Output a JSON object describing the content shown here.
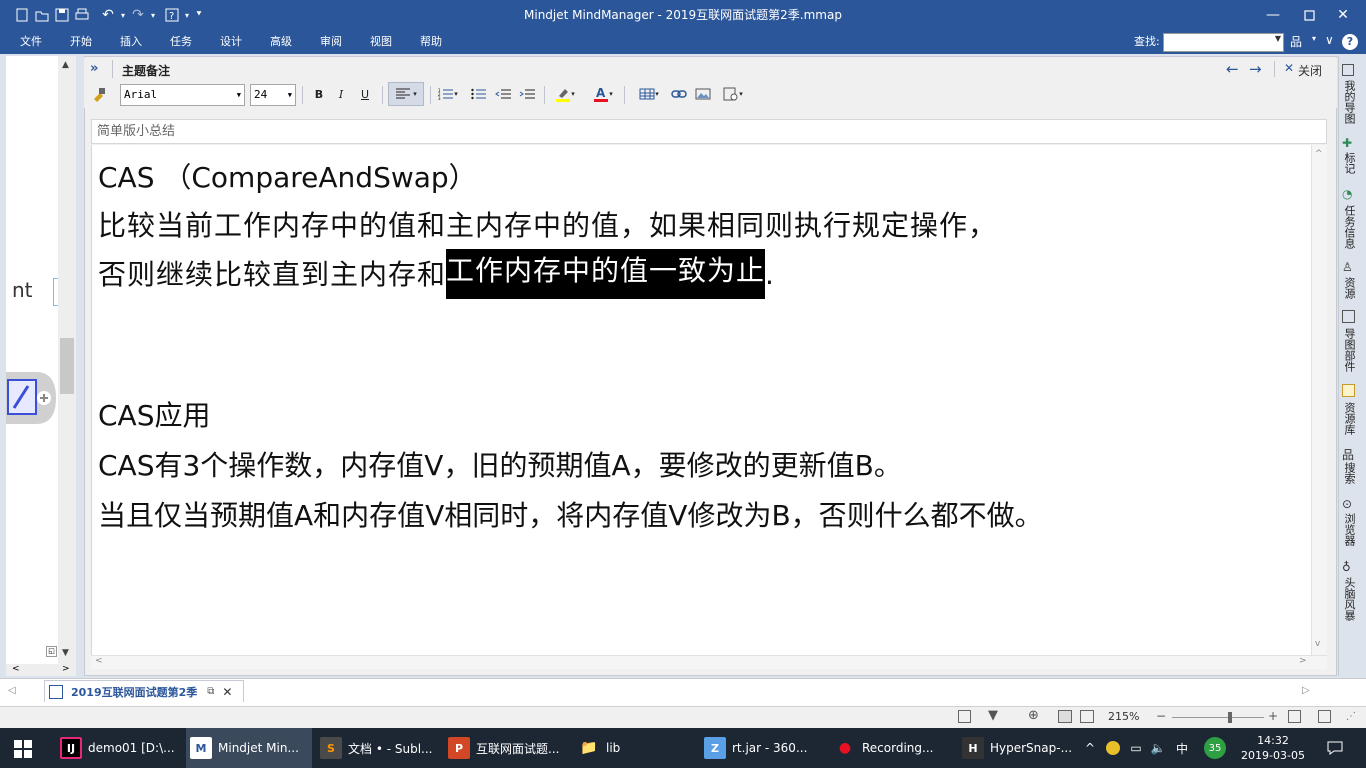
{
  "window": {
    "title": "Mindjet MindManager - 2019互联网面试题第2季.mmap"
  },
  "menu": {
    "items": [
      "文件",
      "开始",
      "插入",
      "任务",
      "设计",
      "高级",
      "审阅",
      "视图",
      "帮助"
    ],
    "find_label": "查找:",
    "find_value": ""
  },
  "left_pane": {
    "partial_text": "nt"
  },
  "notes_panel": {
    "title": "主题备注",
    "close_label": "关闭",
    "font_name": "Arial",
    "font_size": "24",
    "bold": "B",
    "italic": "I",
    "underline": "U",
    "subject": "简单版小总结",
    "lines": [
      "CAS （CompareAndSwap）",
      "比较当前工作内存中的值和主内存中的值，如果相同则执行规定操作，",
      "否则继续比较直到主内存和",
      "工作内存中的值一致为止",
      ".",
      "CAS应用",
      "CAS有3个操作数，内存值V，旧的预期值A，要修改的更新值B。",
      "当且仅当预期值A和内存值V相同时，将内存值V修改为B，否则什么都不做。"
    ]
  },
  "right_sidebar": {
    "tabs": [
      "我的导图",
      "标记",
      "任务信息",
      "资源",
      "导图部件",
      "资源库",
      "搜索",
      "浏览器",
      "头脑风暴"
    ]
  },
  "doc_tab": {
    "label": "2019互联网面试题第2季"
  },
  "status_bar": {
    "zoom": "215%"
  },
  "taskbar": {
    "apps": [
      {
        "label": "demo01 [D:\\...",
        "icon": "IJ"
      },
      {
        "label": "Mindjet Min...",
        "icon": "M"
      },
      {
        "label": "文档 • - Subl...",
        "icon": "S"
      },
      {
        "label": "互联网面试题...",
        "icon": "P"
      },
      {
        "label": "lib",
        "icon": "📁"
      },
      {
        "label": "rt.jar - 360...",
        "icon": "Z"
      },
      {
        "label": "Recording...",
        "icon": "●"
      },
      {
        "label": "HyperSnap-...",
        "icon": "H"
      }
    ],
    "badge": "35",
    "ime": "中",
    "time": "14:32",
    "date": "2019-03-05"
  },
  "colors": {
    "accent": "#2b579a",
    "highlight_bg": "#000000",
    "taskbar": "#1c2733"
  }
}
